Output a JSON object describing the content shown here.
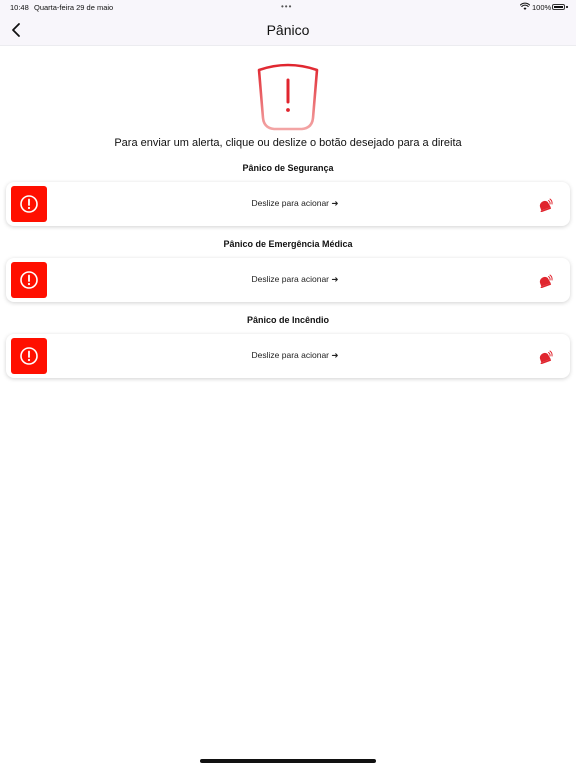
{
  "status_bar": {
    "time": "10:48",
    "date": "Quarta-feira 29 de maio",
    "dots": "•••",
    "battery": "100%"
  },
  "nav": {
    "title": "Pânico",
    "back_icon": "chevron-left-icon"
  },
  "header": {
    "icon": "shield-alert-icon",
    "instruction": "Para enviar um alerta, clique ou deslize o botão desejado para a direita"
  },
  "panics": [
    {
      "title": "Pânico de Segurança",
      "slider_label": "Deslize para acionar ➜"
    },
    {
      "title": "Pânico de Emergência Médica",
      "slider_label": "Deslize para acionar ➜"
    },
    {
      "title": "Pânico de Incêndio",
      "slider_label": "Deslize para acionar ➜"
    }
  ],
  "colors": {
    "accent_red": "#ff0f00",
    "shield_red": "#e0252e",
    "navbar_bg": "#f8f6fb"
  }
}
